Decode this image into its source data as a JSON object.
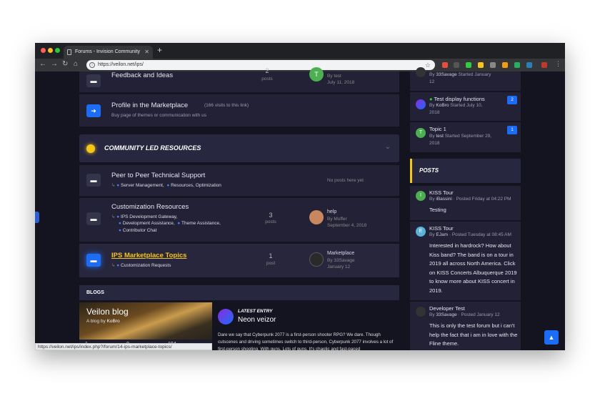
{
  "browser": {
    "tab_title": "Forums - Invision Community",
    "close_glyph": "✕",
    "new_tab_glyph": "+",
    "url": "https://veilon.net/ips/",
    "status_url": "https://veilon.net/ips/index.php?/forum/14-ips-marketplace-topics/"
  },
  "forums": {
    "feedback": {
      "title": "Feedback and Ideas",
      "count": "2",
      "count_label": "posts",
      "lp_by": "By test",
      "lp_date": "July 11, 2018",
      "avatar_letter": "T"
    },
    "profile": {
      "title": "Profile in the Marketplace",
      "visits": "(166 visits to this link)",
      "desc": "Buy page of themes or communication with us"
    },
    "category": {
      "title": "COMMUNITY LED RESOURCES"
    },
    "peer": {
      "title": "Peer to Peer Technical Support",
      "subs": [
        "Server Management,",
        "Resources, Optimization"
      ],
      "no_posts": "No posts here yet"
    },
    "custom": {
      "title": "Customization Resources",
      "subs": [
        "IPS Development Gateway,",
        "Development Assistance,",
        "Theme Assistance,",
        "Contributor Chat"
      ],
      "count": "3",
      "count_label": "posts",
      "lp_title": "help",
      "lp_by": "By Muffer",
      "lp_date": "September 4, 2018"
    },
    "market": {
      "title": "IPS Marketplace Topics",
      "subs": [
        "Customization Requests"
      ],
      "count": "1",
      "count_label": "post",
      "lp_title": "Marketplace",
      "lp_by": "By 33Savage",
      "lp_date": "January 12"
    }
  },
  "blogs": {
    "header": "BLOGS",
    "blog_title": "Veilon blog",
    "blog_by_prefix": "A blog by",
    "blog_by": "KoBro",
    "stats": [
      "1",
      "0",
      "194"
    ],
    "latest_label": "LATEST ENTRY",
    "latest_title": "Neon veizor",
    "latest_text": "Dare we say that Cyberpunk 2077 is a first-person shooter RPG? We dare. Though cutscenes and driving sometimes switch to third-person, Cyberpunk 2077 involves a lot of first-person shooting. With guns. Lots of guns. It's chaotic and fast-paced"
  },
  "sidebar": {
    "topics": [
      {
        "title": "",
        "by": "33Savage",
        "meta": "Started January",
        "meta2": "12"
      },
      {
        "title": "Test display functions",
        "by": "KoBro",
        "meta": "Started July 10,",
        "meta2": "2018",
        "badge": "2"
      },
      {
        "title": "Topic 1",
        "by": "test",
        "meta": "Started September 29,",
        "meta2": "2018",
        "badge": "1",
        "letter": "T"
      }
    ],
    "posts_header": "POSTS",
    "posts": [
      {
        "title": "KISS Tour",
        "by": "iBassini",
        "when": "Posted Friday at 04:22 PM",
        "text": "Testing",
        "letter": "I"
      },
      {
        "title": "KISS Tour",
        "by": "EJam",
        "when": "Posted Tuesday at 08:45 AM",
        "text": "Interested in hardrock? How about Kiss band? The band is on a tour in 2019 all across North America. Click on KISS Concerts Albuquerque 2019 to know more about KISS concert in 2019.",
        "letter": "E"
      },
      {
        "title": "Developer Test",
        "by": "33Savage",
        "when": "Posted January 12",
        "text": "This is only the test forum but i can't help the fact that i am in love with the Fline theme."
      }
    ],
    "by_label": "By"
  },
  "colors": {
    "accent": "#1d6cf5",
    "highlight": "#f5c518",
    "bg": "#141320",
    "panel": "#222135"
  },
  "icons": [
    "forum-icon",
    "redirect-arrow-icon",
    "chat-bubble-icon",
    "scroll-top-icon",
    "back-icon",
    "forward-icon",
    "reload-icon",
    "home-icon",
    "star-icon"
  ]
}
